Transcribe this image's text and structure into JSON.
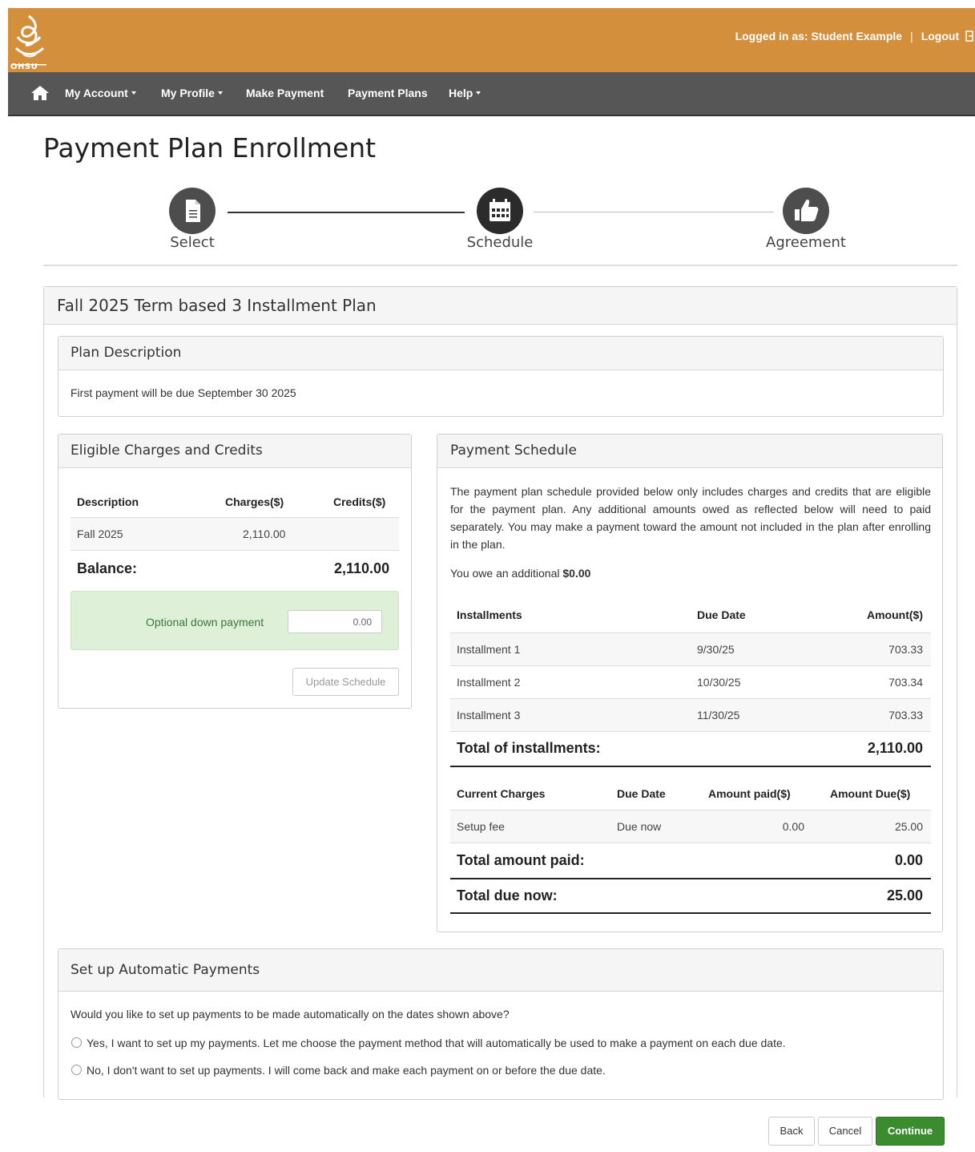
{
  "header": {
    "logo_text": "OHSU",
    "user_label": "Logged in as: Student Example",
    "separator": "|",
    "logout_label": "Logout"
  },
  "nav": {
    "items": [
      {
        "label": "My Account",
        "dropdown": true
      },
      {
        "label": "My Profile",
        "dropdown": true
      },
      {
        "label": "Make Payment",
        "dropdown": false
      },
      {
        "label": "Payment Plans",
        "dropdown": false
      },
      {
        "label": "Help",
        "dropdown": true
      }
    ]
  },
  "page": {
    "title": "Payment Plan Enrollment"
  },
  "stepper": {
    "steps": [
      {
        "label": "Select",
        "icon": "document-icon"
      },
      {
        "label": "Schedule",
        "icon": "calendar-icon"
      },
      {
        "label": "Agreement",
        "icon": "thumbs-up-icon"
      }
    ]
  },
  "plan": {
    "title": "Fall 2025 Term based 3 Installment Plan",
    "description_heading": "Plan Description",
    "description_text": "First payment will be due September 30 2025"
  },
  "eligible": {
    "heading": "Eligible Charges and Credits",
    "columns": [
      "Description",
      "Charges($)",
      "Credits($)"
    ],
    "rows": [
      {
        "description": "Fall 2025",
        "charges": "2,110.00",
        "credits": ""
      }
    ],
    "balance_label": "Balance:",
    "balance_value": "2,110.00",
    "down_payment_label": "Optional down payment",
    "down_payment_value": "0.00",
    "update_button": "Update Schedule"
  },
  "schedule": {
    "heading": "Payment Schedule",
    "intro": "The payment plan schedule provided below only includes charges and credits that are eligible for the payment plan. Any additional amounts owed as reflected below will need to paid separately. You may make a payment toward the amount not included in the plan after enrolling in the plan.",
    "owe_label": "You owe an additional",
    "owe_value": "$0.00",
    "installment_columns": [
      "Installments",
      "Due Date",
      "Amount($)"
    ],
    "installments": [
      {
        "name": "Installment 1",
        "due": "9/30/25",
        "amount": "703.33"
      },
      {
        "name": "Installment 2",
        "due": "10/30/25",
        "amount": "703.34"
      },
      {
        "name": "Installment 3",
        "due": "11/30/25",
        "amount": "703.33"
      }
    ],
    "total_installments_label": "Total of installments:",
    "total_installments_value": "2,110.00",
    "charges_columns": [
      "Current Charges",
      "Due Date",
      "Amount paid($)",
      "Amount Due($)"
    ],
    "charges": [
      {
        "name": "Setup fee",
        "due": "Due now",
        "paid": "0.00",
        "amount_due": "25.00"
      }
    ],
    "total_paid_label": "Total amount paid:",
    "total_paid_value": "0.00",
    "total_due_label": "Total due now:",
    "total_due_value": "25.00"
  },
  "auto": {
    "heading": "Set up Automatic Payments",
    "question": "Would you like to set up payments to be made automatically on the dates shown above?",
    "options": [
      "Yes, I want to set up my payments. Let me choose the payment method that will automatically be used to make a payment on each due date.",
      "No, I don't want to set up payments. I will come back and make each payment on or before the due date."
    ]
  },
  "actions": {
    "back": "Back",
    "cancel": "Cancel",
    "continue": "Continue"
  },
  "colors": {
    "header": "#d38f3c",
    "navbar": "#565656",
    "highlight": "#dff0d8",
    "primary": "#3b8c2e"
  }
}
